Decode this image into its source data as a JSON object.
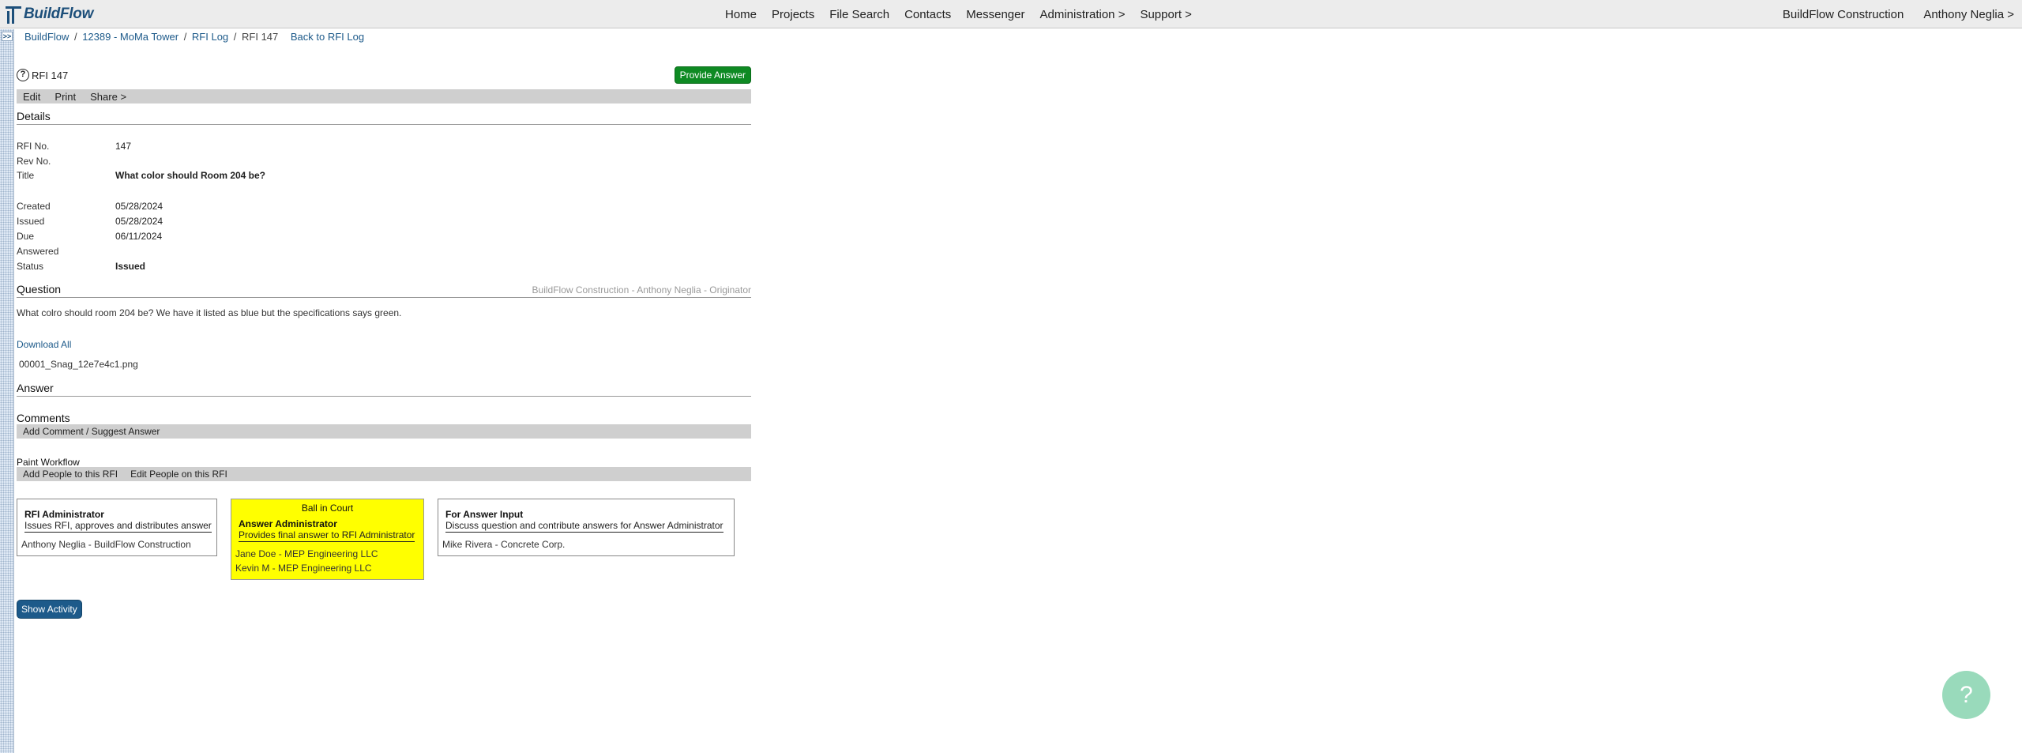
{
  "app": {
    "name": "BuildFlow"
  },
  "nav": {
    "items": [
      "Home",
      "Projects",
      "File Search",
      "Contacts",
      "Messenger",
      "Administration >",
      "Support >"
    ],
    "company": "BuildFlow Construction",
    "user": "Anthony Neglia >"
  },
  "breadcrumb": {
    "items": [
      "BuildFlow",
      "12389 - MoMa Tower",
      "RFI Log",
      "RFI 147"
    ],
    "back": "Back to RFI Log"
  },
  "rfi": {
    "heading": "RFI 147",
    "provide_answer": "Provide Answer",
    "toolbar": [
      "Edit",
      "Print",
      "Share >"
    ]
  },
  "details": {
    "heading": "Details",
    "fields": [
      {
        "label": "RFI No.",
        "value": "147",
        "bold": false
      },
      {
        "label": "Rev No.",
        "value": "",
        "bold": false
      },
      {
        "label": "Title",
        "value": "What color should Room 204 be?",
        "bold": true
      },
      {
        "label": "Created",
        "value": "05/28/2024",
        "bold": false
      },
      {
        "label": "Issued",
        "value": "05/28/2024",
        "bold": false
      },
      {
        "label": "Due",
        "value": "06/11/2024",
        "bold": false
      },
      {
        "label": "Answered",
        "value": "",
        "bold": false
      },
      {
        "label": "Status",
        "value": "Issued",
        "bold": true
      }
    ]
  },
  "question": {
    "heading": "Question",
    "originator": "BuildFlow Construction - Anthony Neglia - Originator",
    "text": "What colro should room 204 be? We have it listed as blue but the specifications says green.",
    "download_all": "Download All",
    "file": "00001_Snag_12e7e4c1.png"
  },
  "answer": {
    "heading": "Answer"
  },
  "comments": {
    "heading": "Comments",
    "add": "Add Comment / Suggest Answer"
  },
  "workflow": {
    "heading": "Paint Workflow",
    "actions": [
      "Add People to this RFI",
      "Edit People on this RFI"
    ],
    "boxes": [
      {
        "role": "RFI Administrator",
        "desc": "Issues RFI, approves and distributes answer",
        "people": [
          "Anthony Neglia - BuildFlow Construction"
        ]
      },
      {
        "ball": "Ball in Court",
        "role": "Answer Administrator",
        "desc": "Provides final answer to RFI Administrator",
        "people": [
          "Jane Doe - MEP Engineering LLC",
          "Kevin M - MEP Engineering LLC"
        ]
      },
      {
        "role": "For Answer Input",
        "desc": "Discuss question and contribute answers for Answer Administrator",
        "people": [
          "Mike Rivera - Concrete Corp."
        ]
      }
    ]
  },
  "show_activity": "Show Activity",
  "help": "?",
  "colors": {
    "brand": "#1d4f7a",
    "provide": "#0e8a23",
    "ball_in_court": "#ffff00",
    "activity": "#1d5a8a"
  }
}
